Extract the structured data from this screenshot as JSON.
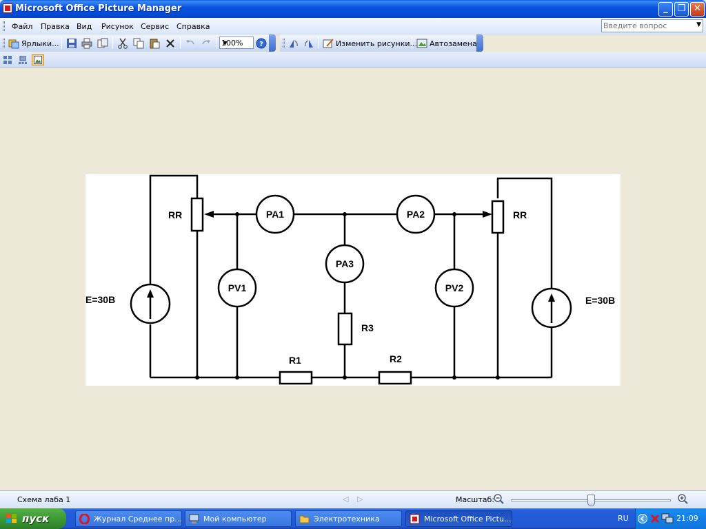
{
  "window": {
    "title": "Microsoft Office Picture Manager",
    "buttons": {
      "minimize": "_",
      "maximize": "❐",
      "close": "✕"
    }
  },
  "menu": {
    "items": [
      "Файл",
      "Правка",
      "Вид",
      "Рисунок",
      "Сервис",
      "Справка"
    ],
    "help_placeholder": "Введите вопрос"
  },
  "toolbar": {
    "shortcuts_label": "Ярлыки...",
    "zoom_value": "100%",
    "edit_pictures_label": "Изменить рисунки...",
    "autocorrect_label": "Автозамена"
  },
  "viewbar": {
    "icons": [
      "thumbnail-view-icon",
      "filmstrip-view-icon",
      "single-picture-view-icon"
    ],
    "active": "single-picture-view-icon"
  },
  "diagram": {
    "labels": {
      "rr_left": "RR",
      "rr_right": "RR",
      "pa1": "PA1",
      "pa2": "PA2",
      "pa3": "PA3",
      "pv1": "PV1",
      "pv2": "PV2",
      "r1": "R1",
      "r2": "R2",
      "r3": "R3",
      "e_left": "E=30B",
      "e_right": "E=30B"
    }
  },
  "status": {
    "file_name": "Схема лаба 1",
    "scale_label": "Масштаб:",
    "zoom_slider_fraction": 0.5
  },
  "taskbar": {
    "start_label": "пуск",
    "tasks": [
      {
        "label": "Журнал Среднее пр...",
        "icon": "opera-icon",
        "active": false
      },
      {
        "label": "Мой компьютер",
        "icon": "my-computer-icon",
        "active": false
      },
      {
        "label": "Электротехника",
        "icon": "folder-icon",
        "active": false
      },
      {
        "label": "Microsoft Office Pictu...",
        "icon": "picture-manager-icon",
        "active": true
      }
    ],
    "language": "RU",
    "clock": "21:09"
  },
  "colors": {
    "title_bar": "#0a54e0",
    "workspace": "#ece9d8",
    "taskbar": "#245edb",
    "start_button": "#3c9a34"
  }
}
